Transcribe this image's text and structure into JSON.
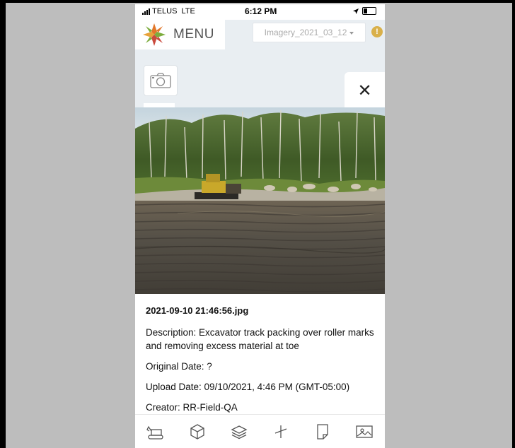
{
  "status_bar": {
    "carrier": "TELUS",
    "network": "LTE",
    "time": "6:12 PM"
  },
  "header": {
    "menu_label": "MENU",
    "imagery_selected": "Imagery_2021_03_12",
    "alert_symbol": "!"
  },
  "photo_panel": {
    "close_symbol": "✕",
    "filename": "2021-09-10 21:46:56.jpg",
    "description": "Description: Excavator track packing over roller marks and removing excess material at toe",
    "original_date": "Original Date: ?",
    "upload_date": "Upload Date: 09/10/2021, 4:46 PM (GMT-05:00)",
    "creator": "Creator: RR-Field-QA"
  },
  "colors": {
    "alert": "#d9b04a",
    "logo_orange": "#e2772a",
    "logo_green": "#7cac3d",
    "logo_red": "#c94a3d"
  },
  "bottom_tools": [
    "excavator-icon",
    "cube-icon",
    "layers-icon",
    "measure-icon",
    "note-icon",
    "image-icon"
  ]
}
